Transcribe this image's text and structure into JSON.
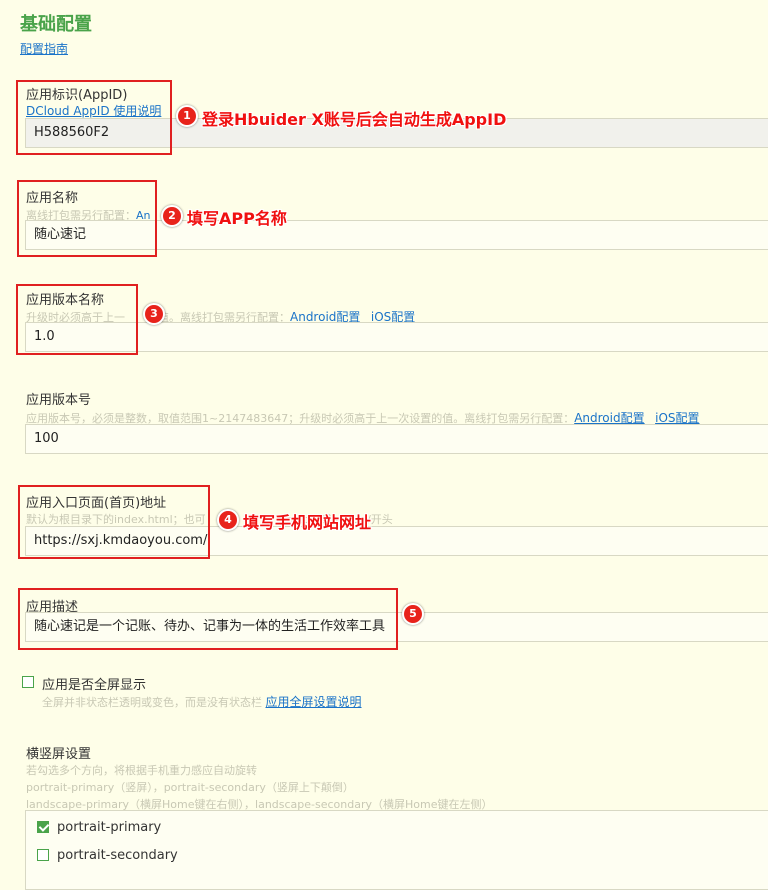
{
  "page": {
    "title": "基础配置",
    "guide_link": "配置指南"
  },
  "appid": {
    "label": "应用标识(AppID)",
    "help_link": "DCloud AppID 使用说明",
    "value": "H588560F2",
    "annotation_number": "1",
    "annotation": "登录Hbuider X账号后会自动生成AppID"
  },
  "app_name": {
    "label": "应用名称",
    "desc": "离线打包需另行配置：",
    "desc_link": "An",
    "value": "随心速记",
    "annotation_number": "2",
    "annotation": "填写APP名称"
  },
  "version_name": {
    "label": "应用版本名称",
    "desc": "升级时必须高于上一",
    "desc_tail": "的值。离线打包需另行配置：",
    "android_link": "Android配置",
    "ios_link": "iOS配置",
    "value": "1.0",
    "annotation_number": "3"
  },
  "version_code": {
    "label": "应用版本号",
    "desc": "应用版本号，必须是整数，取值范围1~2147483647；升级时必须高于上一次设置的值。离线打包需另行配置：",
    "android_link": "Android配置",
    "ios_link": "iOS配置",
    "value": "100"
  },
  "entry": {
    "label": "应用入口页面(首页)地址",
    "desc": "默认为根目录下的index.html；也可",
    "desc_tail": "以http://或https://开头",
    "value": "https://sxj.kmdaoyou.com/",
    "annotation_number": "4",
    "annotation": "填写手机网站网址"
  },
  "description": {
    "label": "应用描述",
    "value": "随心速记是一个记账、待办、记事为一体的生活工作效率工具",
    "annotation_number": "5"
  },
  "fullscreen": {
    "label": "应用是否全屏显示",
    "desc": "全屏并非状态栏透明或变色，而是没有状态栏",
    "link": "应用全屏设置说明",
    "checked": false
  },
  "orientation": {
    "label": "横竖屏设置",
    "desc1": "若勾选多个方向，将根据手机重力感应自动旋转",
    "desc2": "portrait-primary（竖屏），portrait-secondary（竖屏上下颠倒）",
    "desc3": "landscape-primary（横屏Home键在右侧），landscape-secondary（横屏Home键在左侧）",
    "options": [
      {
        "label": "portrait-primary",
        "checked": true
      },
      {
        "label": "portrait-secondary",
        "checked": false
      }
    ]
  },
  "colors": {
    "accent": "#4aa34a",
    "link": "#1a73c8",
    "annotation": "#e02020",
    "background": "#fefee8"
  }
}
